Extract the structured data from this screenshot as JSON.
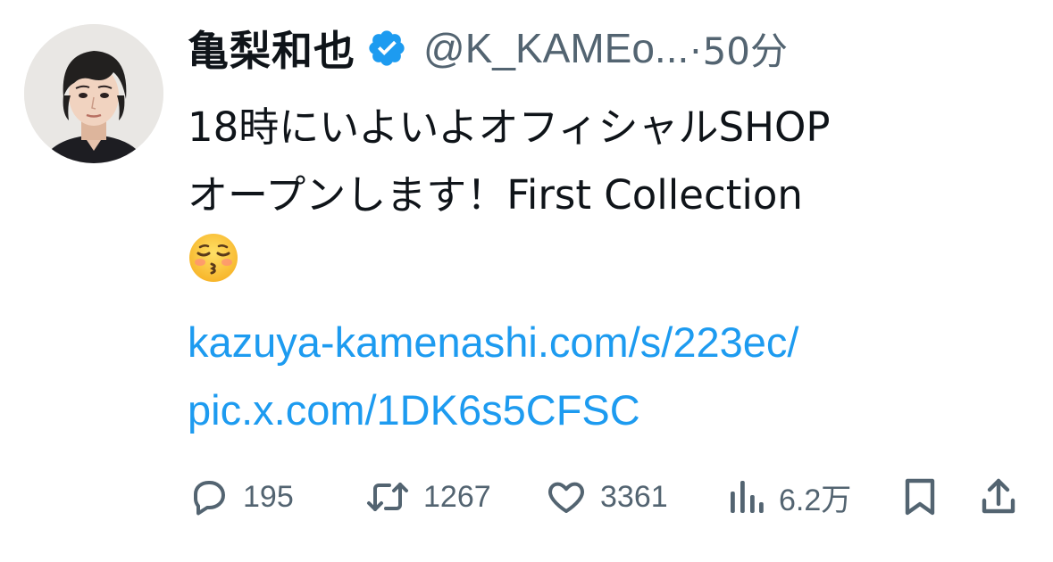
{
  "author": {
    "display_name": "亀梨和也",
    "handle": "@K_KAMEo...",
    "separator": "·",
    "timestamp": "50分",
    "verified_color": "#1d9bf0",
    "avatar_icon": "profile-photo"
  },
  "tweet": {
    "text_line1": "18時にいよいよオフィシャルSHOP",
    "text_line2": "オープンします！First Collection",
    "emoji": "kissing-face-with-closed-eyes",
    "link_url": "kazuya-kamenashi.com/s/223ec/",
    "link_pic": "pic.x.com/1DK6s5CFSC",
    "link_color": "#1d9bf0"
  },
  "actions": {
    "replies": "195",
    "reposts": "1267",
    "likes": "3361",
    "views": "6.2万",
    "icon_color": "#536471"
  }
}
